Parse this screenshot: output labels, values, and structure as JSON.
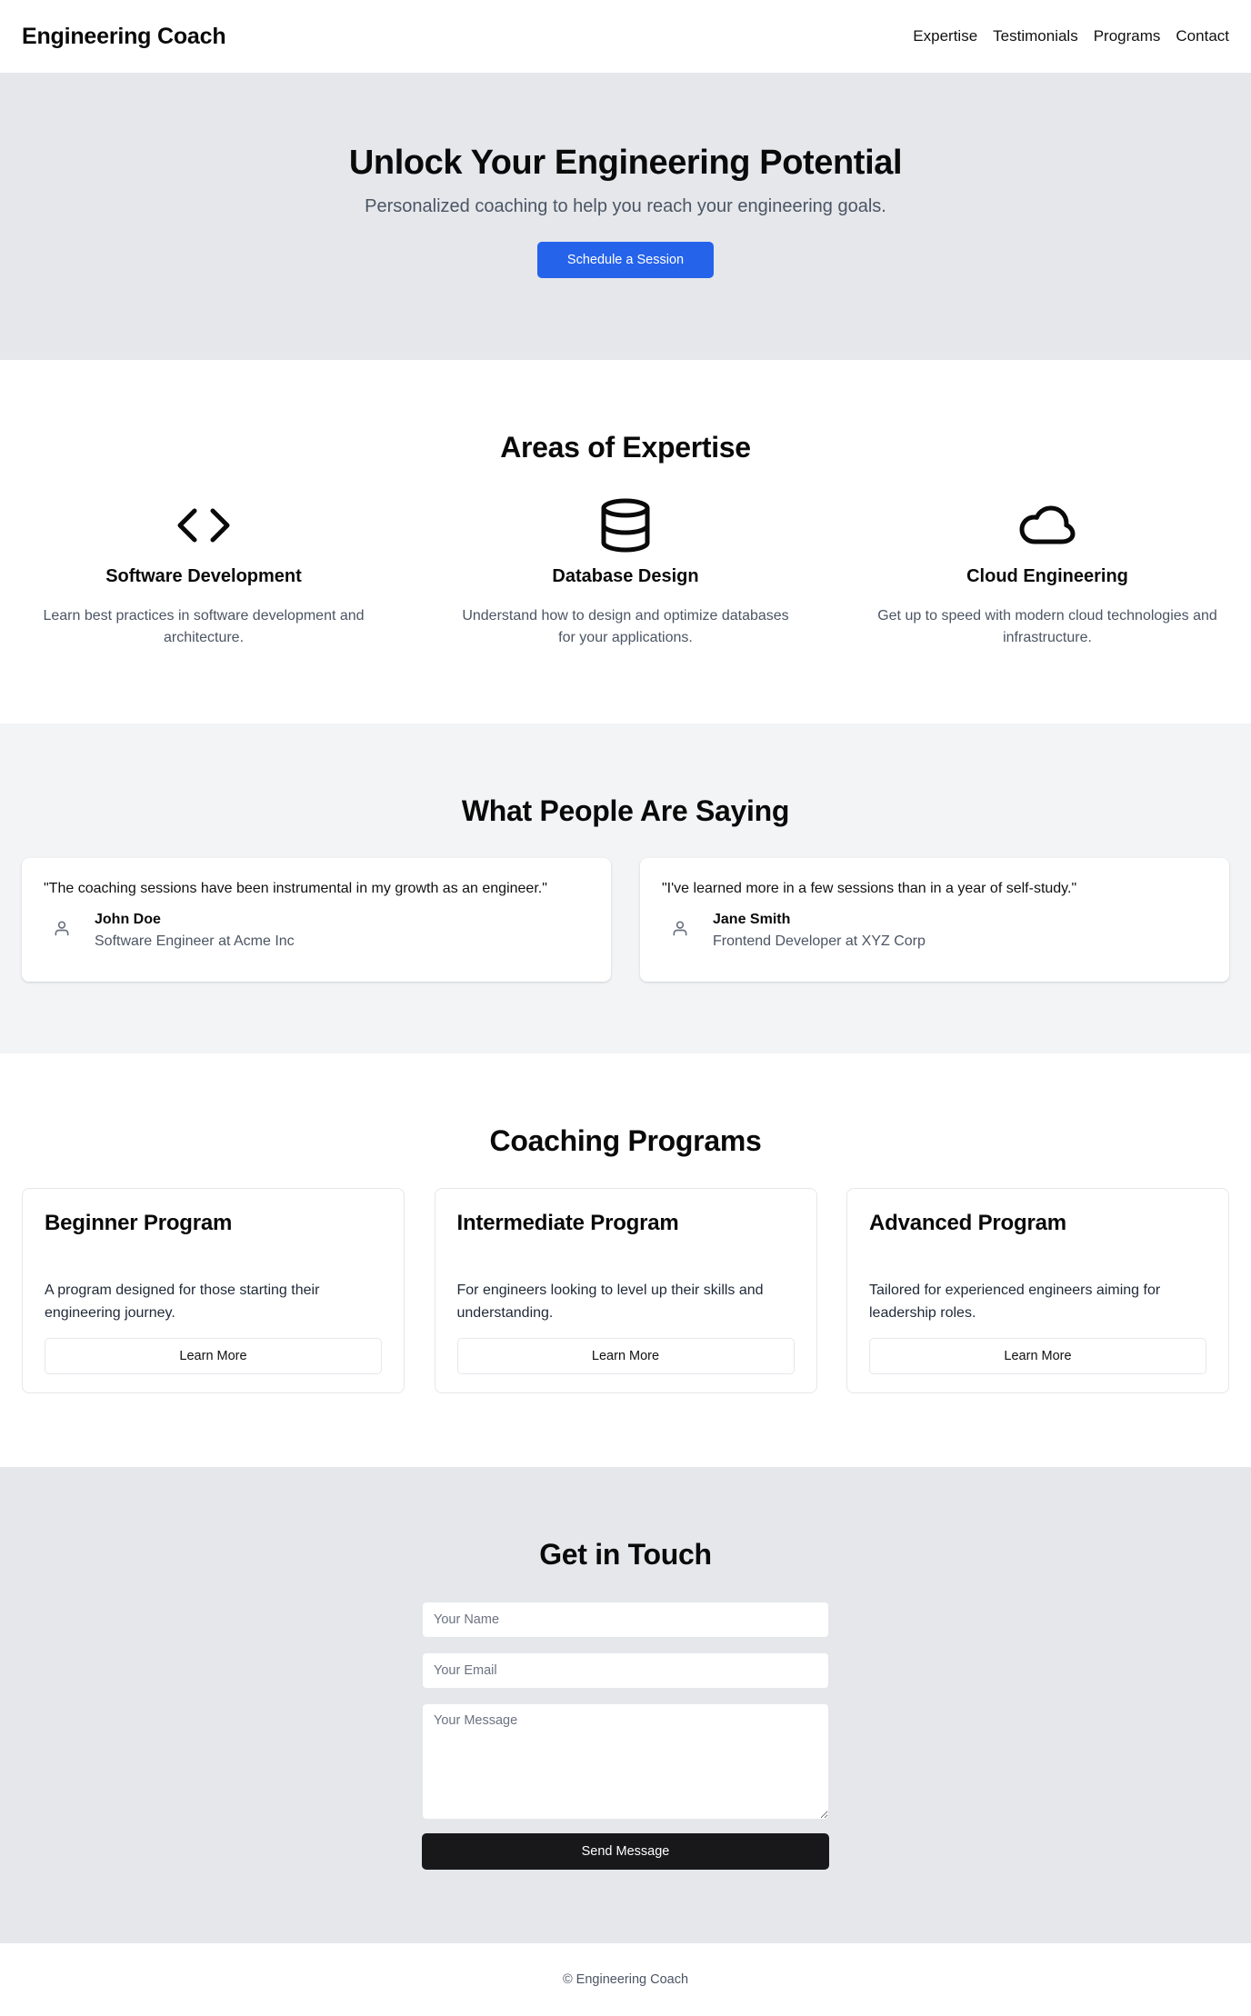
{
  "header": {
    "brand": "Engineering Coach",
    "nav": [
      "Expertise",
      "Testimonials",
      "Programs",
      "Contact"
    ]
  },
  "hero": {
    "title": "Unlock Your Engineering Potential",
    "subtitle": "Personalized coaching to help you reach your engineering goals.",
    "cta": "Schedule a Session",
    "colors": {
      "background": "#e5e7eb",
      "button": "#2563eb"
    }
  },
  "expertise": {
    "title": "Areas of Expertise",
    "items": [
      {
        "icon": "code-icon",
        "title": "Software Development",
        "desc": "Learn best practices in software development and architecture."
      },
      {
        "icon": "database-icon",
        "title": "Database Design",
        "desc": "Understand how to design and optimize databases for your applications."
      },
      {
        "icon": "cloud-icon",
        "title": "Cloud Engineering",
        "desc": "Get up to speed with modern cloud technologies and infrastructure."
      }
    ]
  },
  "testimonials": {
    "title": "What People Are Saying",
    "items": [
      {
        "quote": "\"The coaching sessions have been instrumental in my growth as an engineer.\"",
        "name": "John Doe",
        "role": "Software Engineer at Acme Inc",
        "icon": "user-icon"
      },
      {
        "quote": "\"I've learned more in a few sessions than in a year of self-study.\"",
        "name": "Jane Smith",
        "role": "Frontend Developer at XYZ Corp",
        "icon": "user-icon"
      }
    ]
  },
  "programs": {
    "title": "Coaching Programs",
    "items": [
      {
        "title": "Beginner Program",
        "desc": "A program designed for those starting their engineering journey.",
        "button": "Learn More"
      },
      {
        "title": "Intermediate Program",
        "desc": "For engineers looking to level up their skills and understanding.",
        "button": "Learn More"
      },
      {
        "title": "Advanced Program",
        "desc": "Tailored for experienced engineers aiming for leadership roles.",
        "button": "Learn More"
      }
    ]
  },
  "contact": {
    "title": "Get in Touch",
    "name_placeholder": "Your Name",
    "email_placeholder": "Your Email",
    "message_placeholder": "Your Message",
    "submit": "Send Message",
    "colors": {
      "background": "#e5e7eb",
      "button": "#18181b"
    }
  },
  "footer": {
    "text": "© Engineering Coach"
  }
}
